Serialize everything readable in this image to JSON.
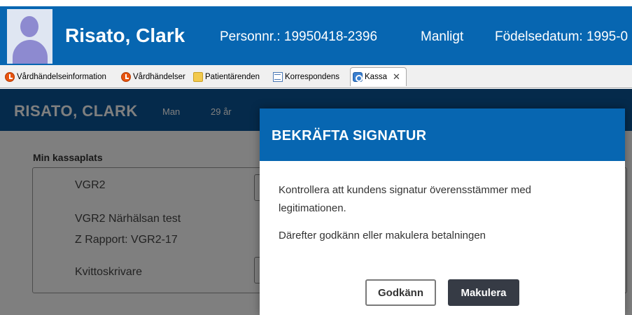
{
  "patient_header": {
    "name": "Risato, Clark",
    "personnr": "Personnr.: 19950418-2396",
    "gender": "Manligt",
    "birthdate": "Födelsedatum: 1995-0"
  },
  "tabs": [
    {
      "label": "Vårdhändelseinformation",
      "icon": "clock-icon"
    },
    {
      "label": "Vårdhändelser",
      "icon": "clock-icon"
    },
    {
      "label": "Patientärenden",
      "icon": "folder-icon"
    },
    {
      "label": "Korrespondens",
      "icon": "mail-icon"
    },
    {
      "label": "Kassa",
      "icon": "kassa-icon",
      "active": true,
      "close": "✕"
    }
  ],
  "app": {
    "patient_name": "RISATO, CLARK",
    "gender": "Man",
    "age": "29 år",
    "section_title": "Min kassaplats",
    "panel": {
      "location": "VGR2",
      "unit": "VGR2 Närhälsan test",
      "report": "Z Rapport: VGR2-17",
      "printer": "Kvittoskrivare"
    }
  },
  "modal": {
    "title": "BEKRÄFTA SIGNATUR",
    "text1": "Kontrollera att kundens signatur överensstämmer med legitimationen.",
    "text2": "Därefter godkänn eller makulera betalningen",
    "approve_label": "Godkänn",
    "cancel_label": "Makulera"
  },
  "colors": {
    "header_blue": "#0766b1",
    "app_header_blue": "#0b5596",
    "cancel_button": "#363b45"
  }
}
